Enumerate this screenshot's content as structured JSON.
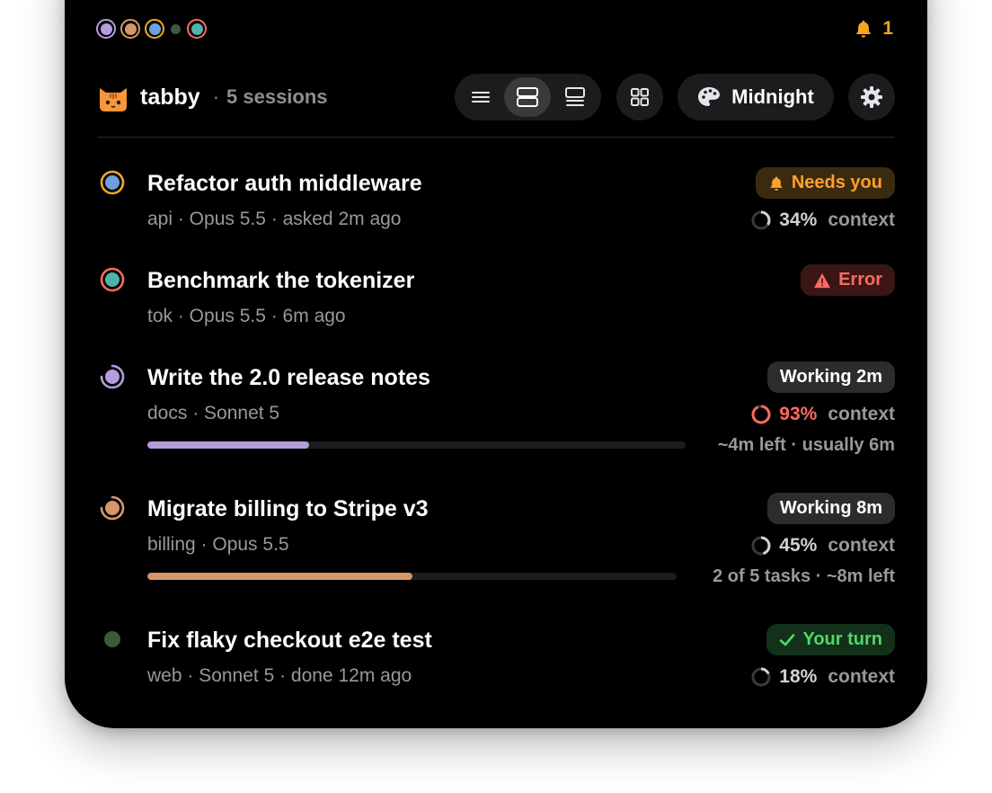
{
  "notifications": {
    "count": "1"
  },
  "header": {
    "app_name": "tabby",
    "separator": "·",
    "session_count": "5 sessions",
    "theme_label": "Midnight"
  },
  "sessions": [
    {
      "title": "Refactor auth middleware",
      "meta": "api · Opus 5.5 · asked 2m ago",
      "badge": "Needs you",
      "badge_icon": "bell-icon",
      "context_pct": "34%",
      "context_value": 0.34,
      "context_label": "context",
      "status_color": "#6ca0dc"
    },
    {
      "title": "Benchmark the tokenizer",
      "meta": "tok · Opus 5.5 · 6m ago",
      "badge": "Error",
      "badge_icon": "warning-icon",
      "status_color": "#4fb3a7"
    },
    {
      "title": "Write the 2.0 release notes",
      "meta": "docs · Sonnet 5",
      "badge": "Working 2m",
      "context_pct": "93%",
      "context_value": 0.93,
      "context_label": "context",
      "progress_value": 0.3,
      "progress_text": "~4m left · usually 6m",
      "status_color": "#b39ddb"
    },
    {
      "title": "Migrate billing to Stripe v3",
      "meta": "billing · Opus 5.5",
      "badge": "Working 8m",
      "context_pct": "45%",
      "context_value": 0.45,
      "context_label": "context",
      "progress_value": 0.5,
      "progress_text": "2 of 5 tasks · ~8m left",
      "status_color": "#d4976a"
    },
    {
      "title": "Fix flaky checkout e2e test",
      "meta": "web · Sonnet 5 · done 12m ago",
      "badge": "Your turn",
      "badge_icon": "checkmark-icon",
      "context_pct": "18%",
      "context_value": 0.18,
      "context_label": "context",
      "status_color": "#3d5a40"
    }
  ],
  "colors": {
    "needs_you": "#ff9f0a",
    "error": "#ff6961",
    "your_turn": "#4cd964",
    "working_bg": "#2c2c2e"
  }
}
